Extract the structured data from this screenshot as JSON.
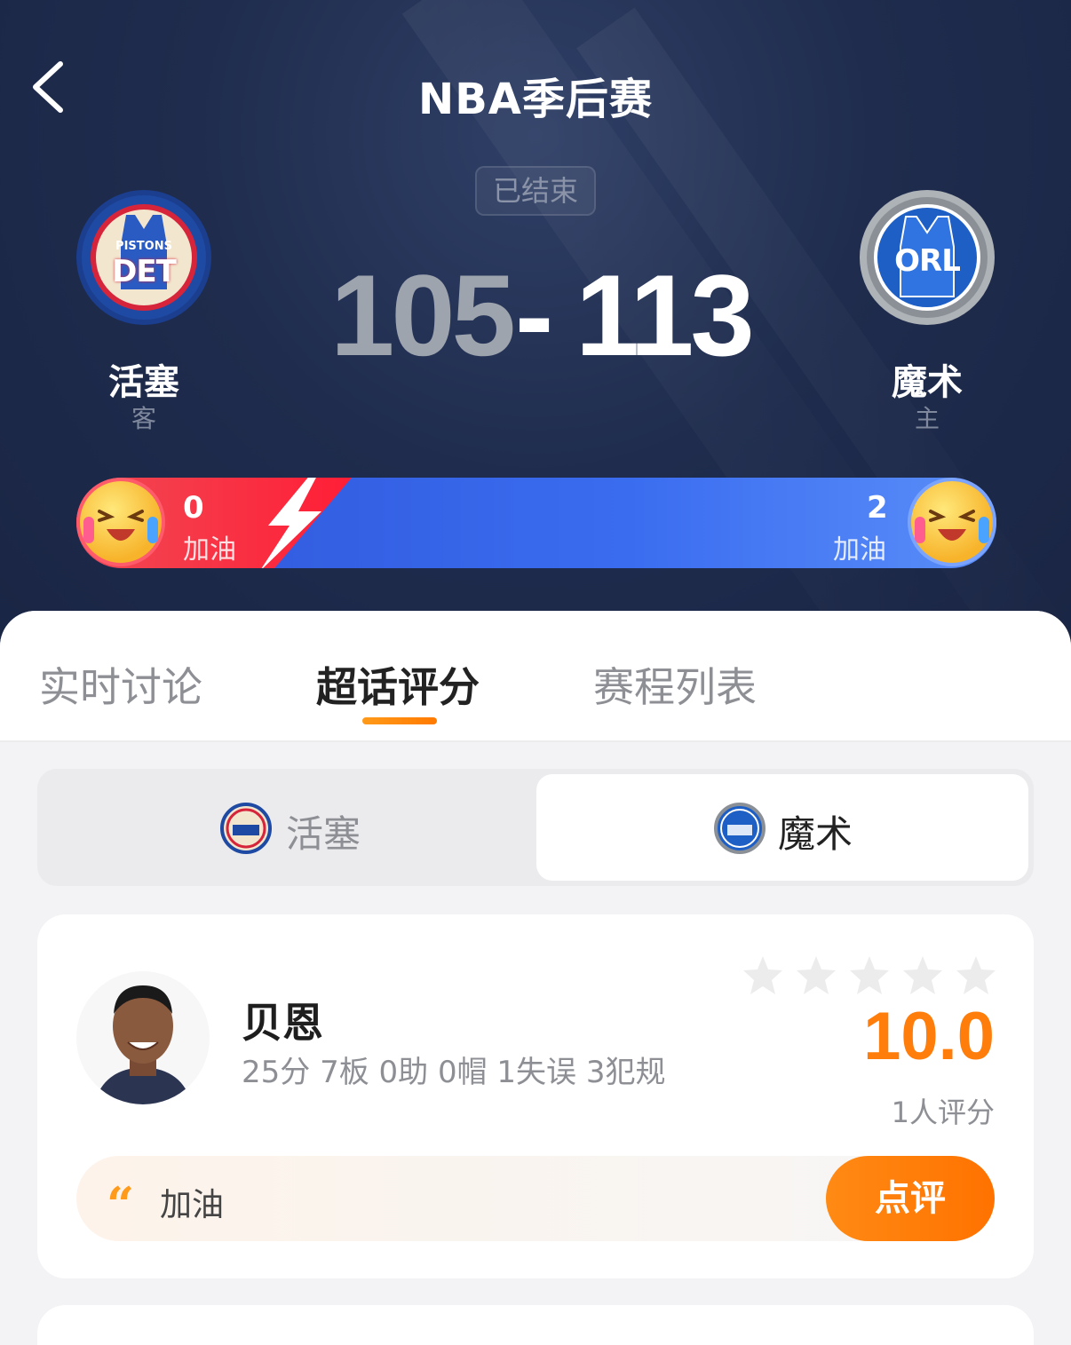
{
  "header": {
    "title": "NBA季后赛",
    "status": "已结束"
  },
  "away_team": {
    "name": "活塞",
    "role": "客",
    "logo_top_text": "PISTONS",
    "logo_main_text": "DET",
    "score": "105",
    "cheer_count": "0",
    "cheer_label": "加油",
    "color": "#d6253b"
  },
  "home_team": {
    "name": "魔术",
    "role": "主",
    "logo_main_text": "ORL",
    "score": "113",
    "cheer_count": "2",
    "cheer_label": "加油",
    "color": "#1e5fc6"
  },
  "score_separator": "-",
  "tabs": [
    {
      "label": "实时讨论",
      "active": false
    },
    {
      "label": "超话评分",
      "active": true
    },
    {
      "label": "赛程列表",
      "active": false
    }
  ],
  "team_switch": [
    {
      "label": "活塞",
      "active": false
    },
    {
      "label": "魔术",
      "active": true
    }
  ],
  "player_card": {
    "name": "贝恩",
    "stats": "25分 7板 0助 0帽 1失误 3犯规",
    "rating": "10.0",
    "rating_count": "1人评分",
    "stars_filled": 0,
    "stars_total": 5,
    "comment": "加油",
    "review_button": "点评"
  },
  "colors": {
    "accent": "#ff7d0a",
    "header_bg": "#1f2c4d",
    "cheer_red": "#ff1e36",
    "cheer_blue": "#3a6cf0"
  }
}
